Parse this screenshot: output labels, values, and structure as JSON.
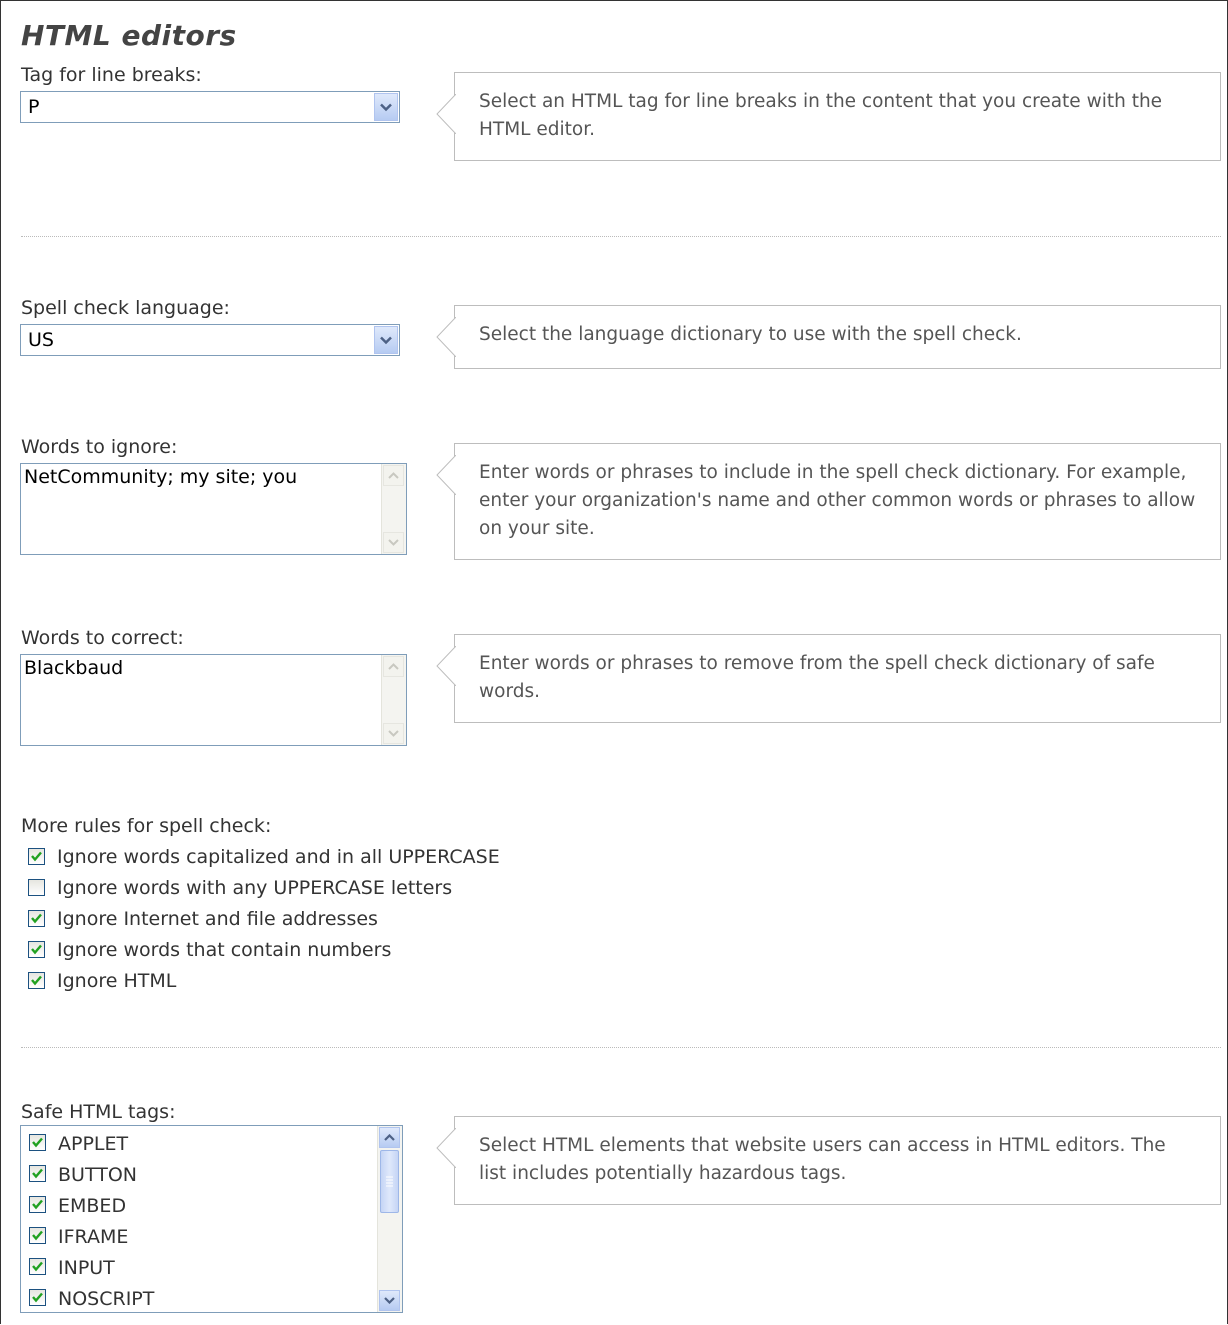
{
  "page": {
    "title": "HTML editors"
  },
  "line_breaks": {
    "label": "Tag for line breaks:",
    "value": "P",
    "help": "Select an HTML tag for line breaks in the content that you create with the HTML editor."
  },
  "spell_language": {
    "label": "Spell check language:",
    "value": "US",
    "help": "Select the language dictionary to use with the spell check."
  },
  "words_ignore": {
    "label": "Words to ignore:",
    "value": "NetCommunity; my site; you",
    "help": "Enter words or phrases to include in the spell check dictionary. For example, enter your organization's name and other common words or phrases to allow on your site."
  },
  "words_correct": {
    "label": "Words to correct:",
    "value": "Blackbaud",
    "help": "Enter words or phrases to remove from the spell check dictionary of safe words."
  },
  "rules": {
    "label": "More rules for spell check:",
    "items": [
      {
        "label": "Ignore words capitalized and in all UPPERCASE",
        "checked": true
      },
      {
        "label": "Ignore words with any UPPERCASE letters",
        "checked": false
      },
      {
        "label": "Ignore Internet and file addresses",
        "checked": true
      },
      {
        "label": "Ignore words that contain numbers",
        "checked": true
      },
      {
        "label": "Ignore HTML",
        "checked": true
      }
    ]
  },
  "safe_tags": {
    "label": "Safe HTML tags:",
    "help": "Select HTML elements that website users can access in HTML editors. The list includes potentially hazardous tags.",
    "items": [
      {
        "label": "APPLET",
        "checked": true
      },
      {
        "label": "BUTTON",
        "checked": true
      },
      {
        "label": "EMBED",
        "checked": true
      },
      {
        "label": "IFRAME",
        "checked": true
      },
      {
        "label": "INPUT",
        "checked": true
      },
      {
        "label": "NOSCRIPT",
        "checked": true
      }
    ]
  },
  "icons": {
    "dropdown": "chevron-down-icon",
    "scroll_up": "arrow-up-icon",
    "scroll_down": "arrow-down-icon",
    "check": "checkmark-icon"
  },
  "colors": {
    "check": "#21a121",
    "arrow": "#4d6185",
    "field_border": "#7f9db9"
  }
}
